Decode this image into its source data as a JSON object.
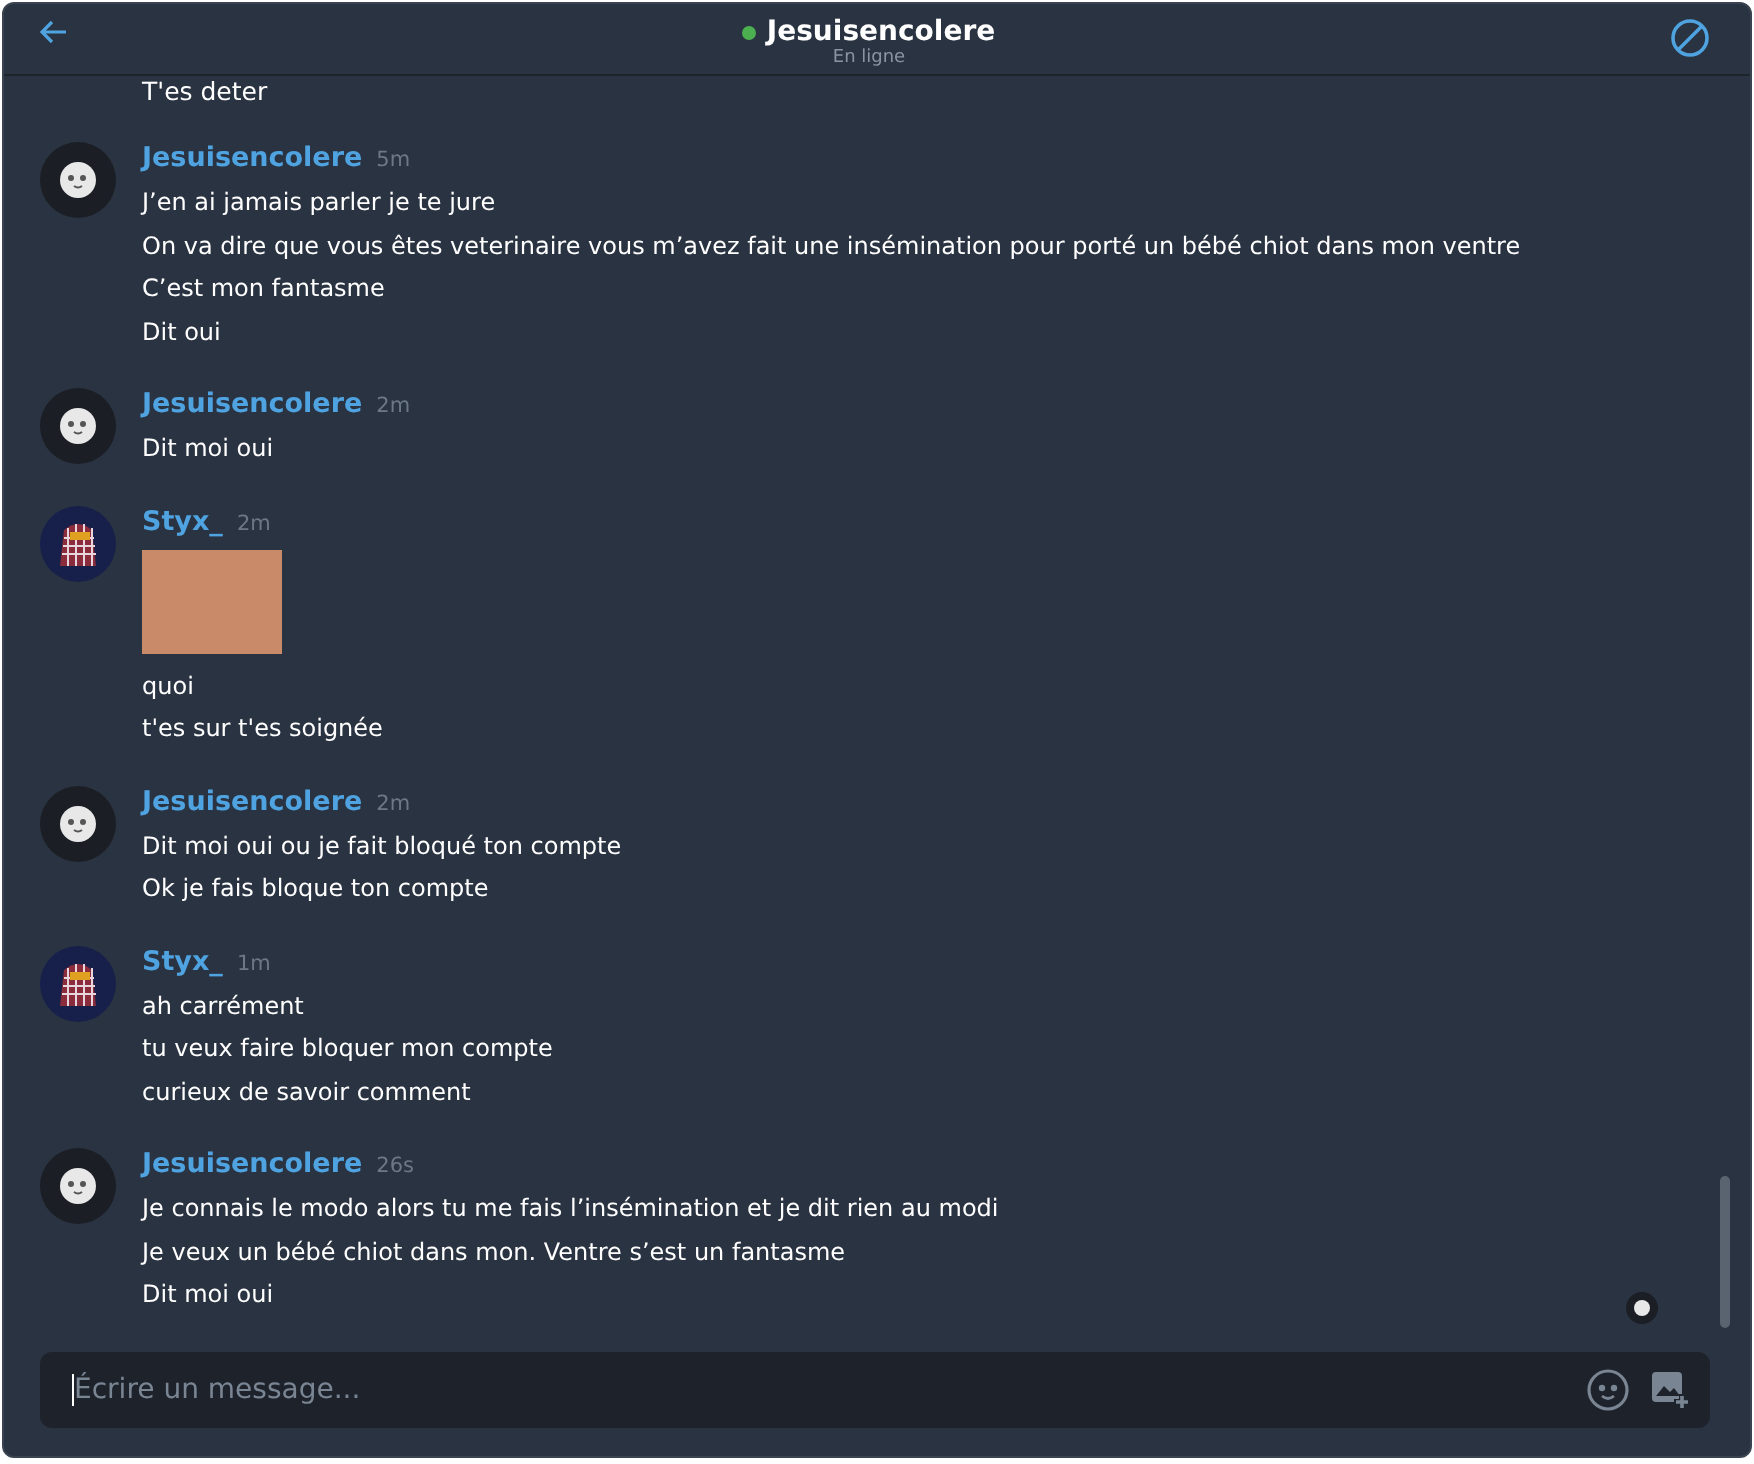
{
  "header": {
    "title": "Jesuisencolere",
    "online": true,
    "status": "En ligne"
  },
  "previous_line": "T'es deter",
  "messages": [
    {
      "author": "Jesuisencolere",
      "kind": "face",
      "time": "5m",
      "content": [
        {
          "kind": "text",
          "text": "J’en ai jamais parler je te jure"
        },
        {
          "kind": "text",
          "text": "On va dire que vous êtes veterinaire vous m’avez fait une insémination pour porté un bébé chiot dans mon ventre"
        },
        {
          "kind": "text",
          "text": "C’est mon fantasme"
        },
        {
          "kind": "text",
          "text": "Dit oui"
        }
      ]
    },
    {
      "author": "Jesuisencolere",
      "kind": "face",
      "time": "2m",
      "content": [
        {
          "kind": "text",
          "text": "Dit moi oui"
        }
      ]
    },
    {
      "author": "Styx_",
      "kind": "pattern",
      "time": "2m",
      "content": [
        {
          "kind": "image"
        },
        {
          "kind": "text",
          "text": "quoi"
        },
        {
          "kind": "text",
          "text": "t'es sur t'es soignée"
        }
      ]
    },
    {
      "author": "Jesuisencolere",
      "kind": "face",
      "time": "2m",
      "content": [
        {
          "kind": "text",
          "text": "Dit moi oui ou je fait bloqué ton compte"
        },
        {
          "kind": "text",
          "text": "Ok je fais bloque ton compte"
        }
      ]
    },
    {
      "author": "Styx_",
      "kind": "pattern",
      "time": "1m",
      "content": [
        {
          "kind": "text",
          "text": "ah carrément"
        },
        {
          "kind": "text",
          "text": "tu veux faire bloquer mon compte"
        },
        {
          "kind": "text",
          "text": "curieux de savoir comment"
        }
      ]
    },
    {
      "author": "Jesuisencolere",
      "kind": "face",
      "time": "26s",
      "content": [
        {
          "kind": "text",
          "text": "Je connais le modo alors tu me fais l’insémination et je dit rien au modi"
        },
        {
          "kind": "text",
          "text": "Je veux un bébé chiot dans mon. Ventre s’est un fantasme"
        },
        {
          "kind": "text",
          "text": "Dit moi oui"
        }
      ]
    }
  ],
  "composer": {
    "placeholder": "Écrire un message..."
  }
}
